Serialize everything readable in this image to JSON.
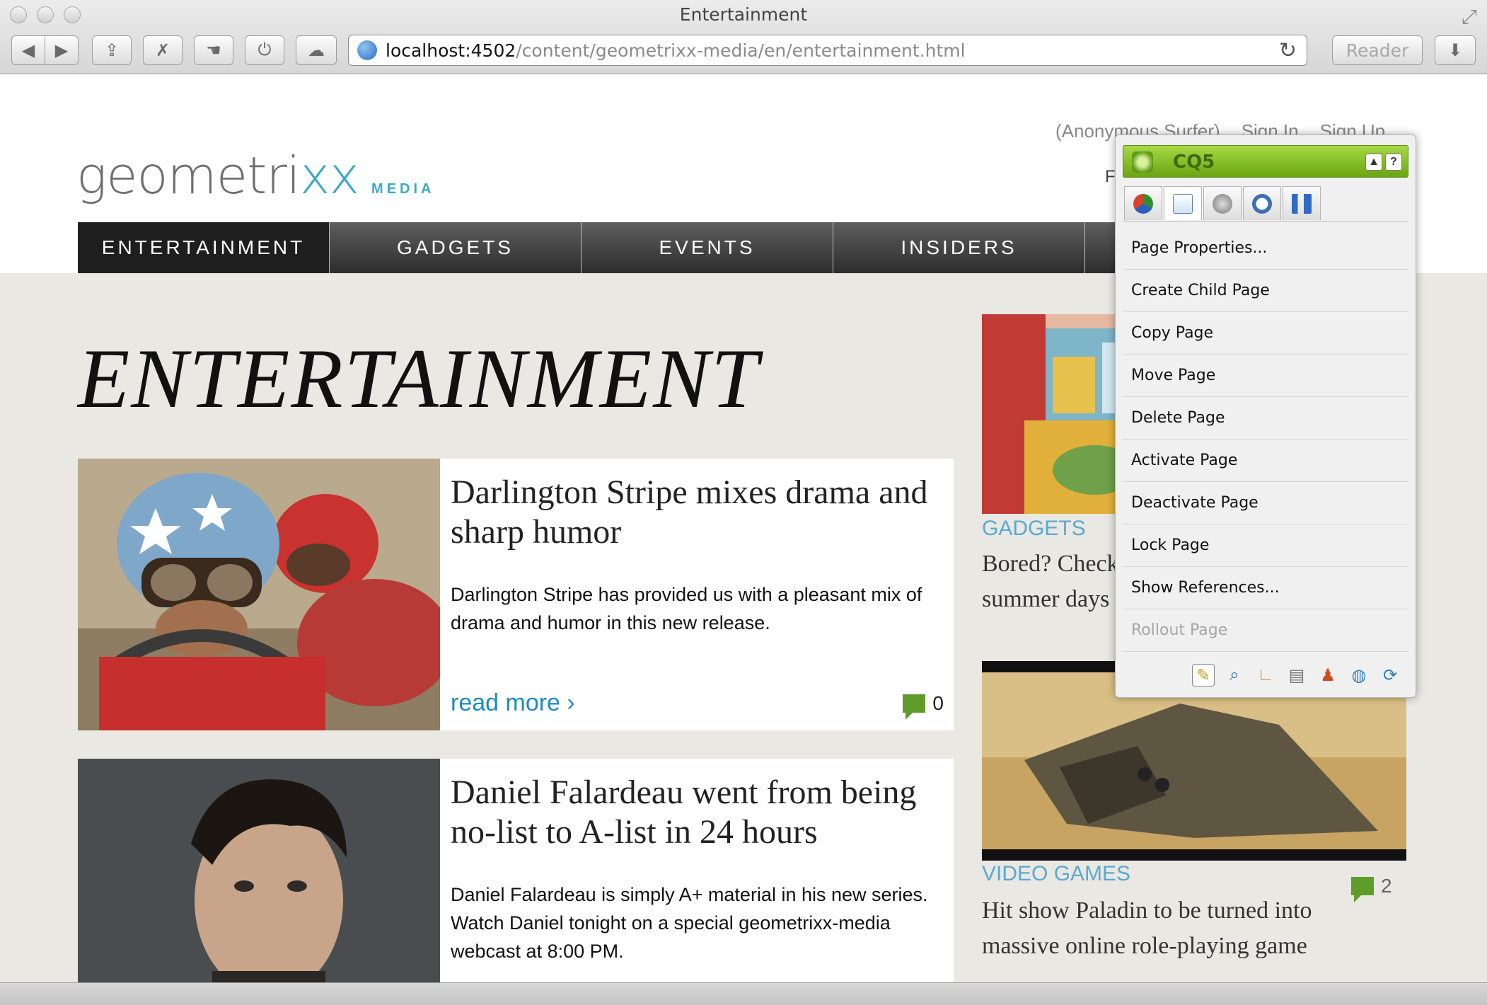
{
  "browser": {
    "window_title": "Entertainment",
    "url_host": "localhost:4502",
    "url_path": "/content/geometrixx-media/en/entertainment.html",
    "reader_label": "Reader"
  },
  "site": {
    "logo_text": "geometri",
    "logo_xx": "xx",
    "logo_sub": "MEDIA",
    "user_links": [
      "(Anonymous Surfer)",
      "Sign In",
      "Sign Up"
    ],
    "user_extra": "F",
    "nav": [
      "ENTERTAINMENT",
      "GADGETS",
      "EVENTS",
      "INSIDERS"
    ],
    "active_nav": "ENTERTAINMENT",
    "page_heading": "ENTERTAINMENT"
  },
  "articles": [
    {
      "title": "Darlington Stripe mixes drama and sharp humor",
      "body": "Darlington Stripe has provided us with a pleasant mix of drama and humor in this new release.",
      "read_more": "read more ›",
      "comments": "0"
    },
    {
      "title": "Daniel Falardeau went from being no-list to A-list in 24 hours",
      "body": "Daniel Falardeau is simply A+ material in his new series. Watch Daniel tonight on a special geometrixx-media webcast at 8:00 PM."
    }
  ],
  "side": [
    {
      "category": "GADGETS",
      "title": "Bored? Check out what to do on hot summer days"
    },
    {
      "category": "VIDEO GAMES",
      "title": "Hit show Paladin to be turned into massive online role-playing game",
      "comments": "2"
    }
  ],
  "sidekick": {
    "title": "CQ5",
    "menu": [
      {
        "label": "Page Properties...",
        "enabled": true
      },
      {
        "label": "Create Child Page",
        "enabled": true
      },
      {
        "label": "Copy Page",
        "enabled": true
      },
      {
        "label": "Move Page",
        "enabled": true
      },
      {
        "label": "Delete Page",
        "enabled": true
      },
      {
        "label": "Activate Page",
        "enabled": true
      },
      {
        "label": "Deactivate Page",
        "enabled": true
      },
      {
        "label": "Lock Page",
        "enabled": true
      },
      {
        "label": "Show References...",
        "enabled": true
      },
      {
        "label": "Rollout Page",
        "enabled": false
      }
    ],
    "tabs": [
      "components-icon",
      "page-icon",
      "lock-icon",
      "versioning-icon",
      "workflow-icon"
    ],
    "footer_icons": [
      "pencil-icon",
      "magnifier-icon",
      "design-icon",
      "scaffold-icon",
      "client-context-icon",
      "globe-icon",
      "refresh-icon"
    ]
  }
}
